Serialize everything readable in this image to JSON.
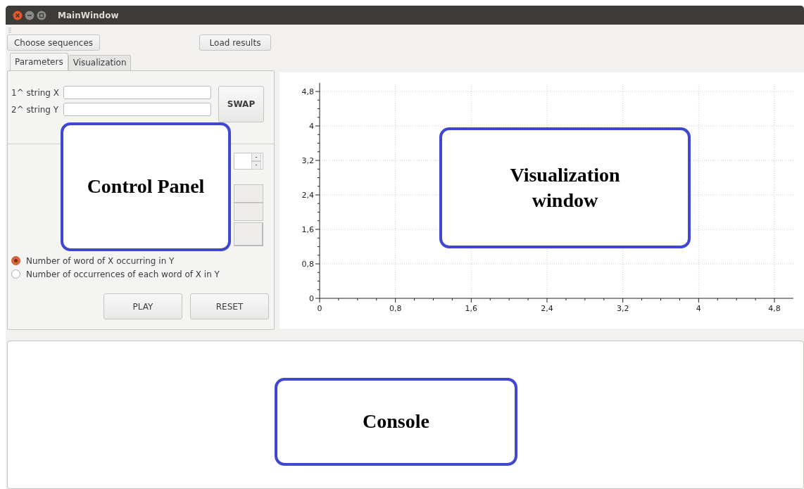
{
  "window": {
    "title": "MainWindow"
  },
  "toolbar": {
    "buttons": [
      {
        "label": "Choose sequences"
      },
      {
        "label": "Load results"
      }
    ]
  },
  "tabs": [
    {
      "label": "Parameters",
      "selected": true
    },
    {
      "label": "Visualization",
      "selected": false
    }
  ],
  "parameters": {
    "fields": [
      {
        "label": "1^ string X"
      },
      {
        "label": "2^ string Y"
      }
    ],
    "swap_button": "SWAP",
    "radios": [
      {
        "label": "Number of word of X occurring in Y",
        "selected": true
      },
      {
        "label": "Number of occurrences  of each word of X in Y",
        "selected": false
      }
    ],
    "buttons": [
      {
        "label": "PLAY"
      },
      {
        "label": "RESET"
      }
    ]
  },
  "visualization": {
    "chart_data": {
      "type": "scatter",
      "grid": true,
      "xlim": [
        0,
        5
      ],
      "ylim": [
        0,
        5
      ],
      "xticks": [
        0,
        {
          "value": 0.8,
          "label": "0,8"
        },
        {
          "value": 1.6,
          "label": "1,6"
        },
        {
          "value": 2.4,
          "label": "2,4"
        },
        {
          "value": 3.2,
          "label": "3,2"
        },
        4,
        {
          "value": 4.8,
          "label": "4,8"
        }
      ],
      "yticks": [
        0,
        {
          "value": 0.8,
          "label": "0,8"
        },
        {
          "value": 1.6,
          "label": "1,6"
        },
        {
          "value": 2.4,
          "label": "2,4"
        },
        {
          "value": 3.2,
          "label": "3,2"
        },
        4,
        {
          "value": 4.8,
          "label": "4,8"
        }
      ]
    }
  },
  "annotations": [
    {
      "text": "Control Panel"
    },
    {
      "text": "Visualization window"
    },
    {
      "text": "Console"
    }
  ]
}
